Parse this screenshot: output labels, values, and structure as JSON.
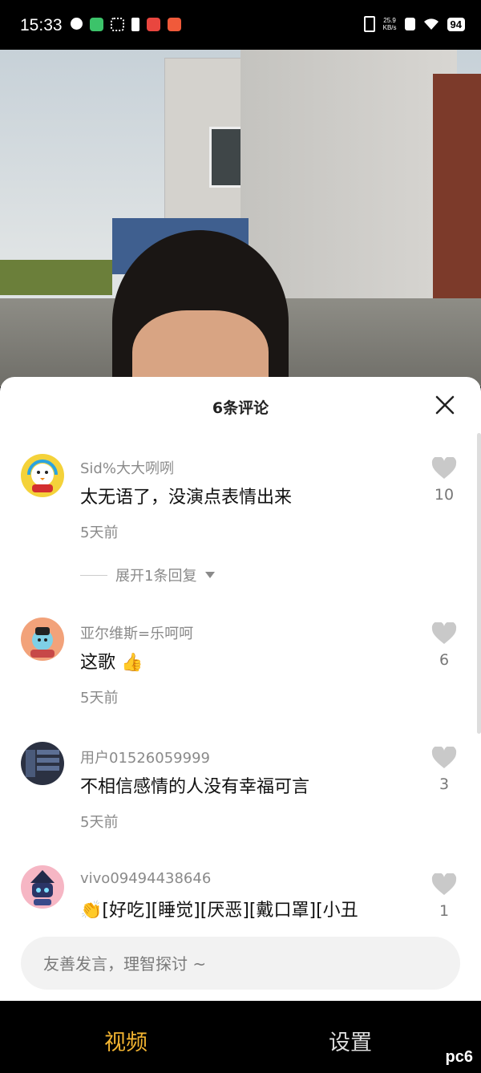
{
  "status_bar": {
    "time": "15:33",
    "net_speed_value": "25.9",
    "net_speed_unit": "KB/s",
    "battery": "94"
  },
  "sheet": {
    "title": "6条评论"
  },
  "comments": [
    {
      "user": "Sid%大大咧咧",
      "text": "太无语了，没演点表情出来",
      "date": "5天前",
      "likes": "10",
      "expand": "展开1条回复"
    },
    {
      "user": "亚尔维斯=乐呵呵",
      "text": "这歌",
      "emoji": "👍",
      "date": "5天前",
      "likes": "6"
    },
    {
      "user": "用户01526059999",
      "text": "不相信感情的人没有幸福可言",
      "date": "5天前",
      "likes": "3"
    },
    {
      "user": "vivo09494438646",
      "emoji": "👏",
      "text": "[好吃][睡觉][厌恶][戴口罩][小丑",
      "likes": "1"
    }
  ],
  "input": {
    "placeholder": "友善发言，理智探讨 ~"
  },
  "tabs": {
    "video": "视频",
    "settings": "设置"
  },
  "watermark": "pc6",
  "colors": {
    "accent": "#f2b431",
    "sheet_bg": "#ffffff",
    "secondary_text": "#8a8a8a"
  }
}
